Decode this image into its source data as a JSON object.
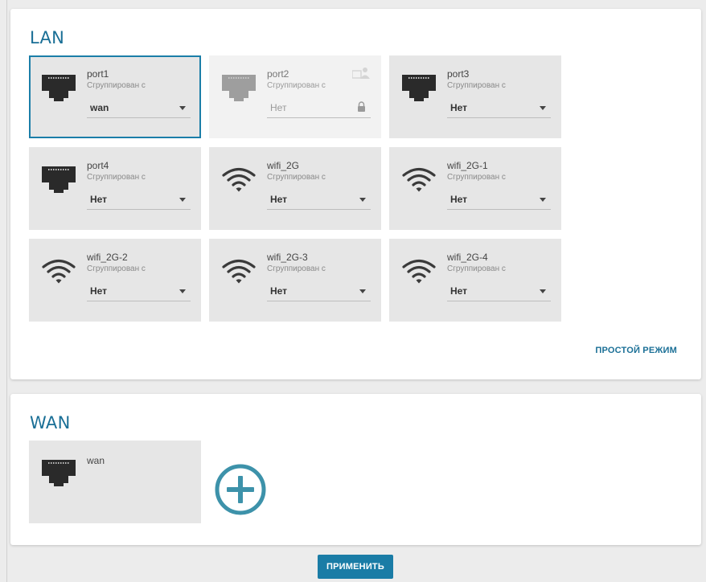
{
  "lan": {
    "title": "LAN",
    "grouped_label": "Сгруппирован с",
    "simple_mode_label": "ПРОСТОЙ РЕЖИМ",
    "ports": [
      {
        "name": "port1",
        "value": "wan",
        "icon": "ethernet-port-icon",
        "state": "selected"
      },
      {
        "name": "port2",
        "value": "Нет",
        "icon": "ethernet-port-icon",
        "state": "disabled"
      },
      {
        "name": "port3",
        "value": "Нет",
        "icon": "ethernet-port-icon",
        "state": "normal"
      },
      {
        "name": "port4",
        "value": "Нет",
        "icon": "ethernet-port-icon",
        "state": "normal"
      },
      {
        "name": "wifi_2G",
        "value": "Нет",
        "icon": "wifi-icon",
        "state": "normal"
      },
      {
        "name": "wifi_2G-1",
        "value": "Нет",
        "icon": "wifi-icon",
        "state": "normal"
      },
      {
        "name": "wifi_2G-2",
        "value": "Нет",
        "icon": "wifi-icon",
        "state": "normal"
      },
      {
        "name": "wifi_2G-3",
        "value": "Нет",
        "icon": "wifi-icon",
        "state": "normal"
      },
      {
        "name": "wifi_2G-4",
        "value": "Нет",
        "icon": "wifi-icon",
        "state": "normal"
      }
    ]
  },
  "wan": {
    "title": "WAN",
    "ports": [
      {
        "name": "wan",
        "icon": "ethernet-port-icon"
      }
    ],
    "add_icon": "plus-circle-icon"
  },
  "footer": {
    "apply_label": "ПРИМЕНИТЬ"
  },
  "colors": {
    "accent": "#1a7ca6",
    "tile_bg": "#e6e6e6",
    "page_bg": "#ececec"
  }
}
